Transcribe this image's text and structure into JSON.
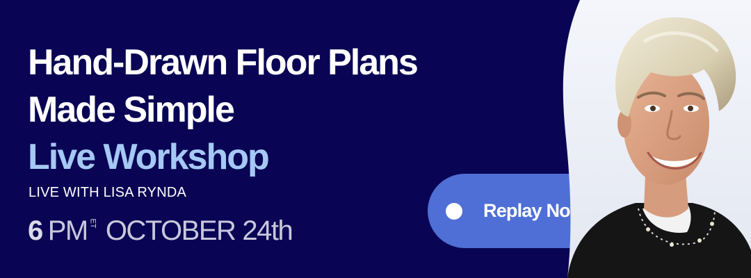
{
  "banner": {
    "title_line1": "Hand-Drawn Floor Plans",
    "title_line2": "Made Simple",
    "title_line3": "Live Workshop",
    "host": "LIVE WITH LISA RYNDA",
    "time_hour": "6",
    "time_period": "PM",
    "time_zone": "ET",
    "month": "OCTOBER",
    "day": "24th"
  },
  "cta": {
    "label": "Replay Now"
  },
  "colors": {
    "background": "#090554",
    "title": "#ffffff",
    "accent_text": "#a6c8f4",
    "button": "#4f6fd6",
    "date_text": "#c9c8dc"
  },
  "icons": {
    "button_indicator": "circle-dot-icon"
  }
}
